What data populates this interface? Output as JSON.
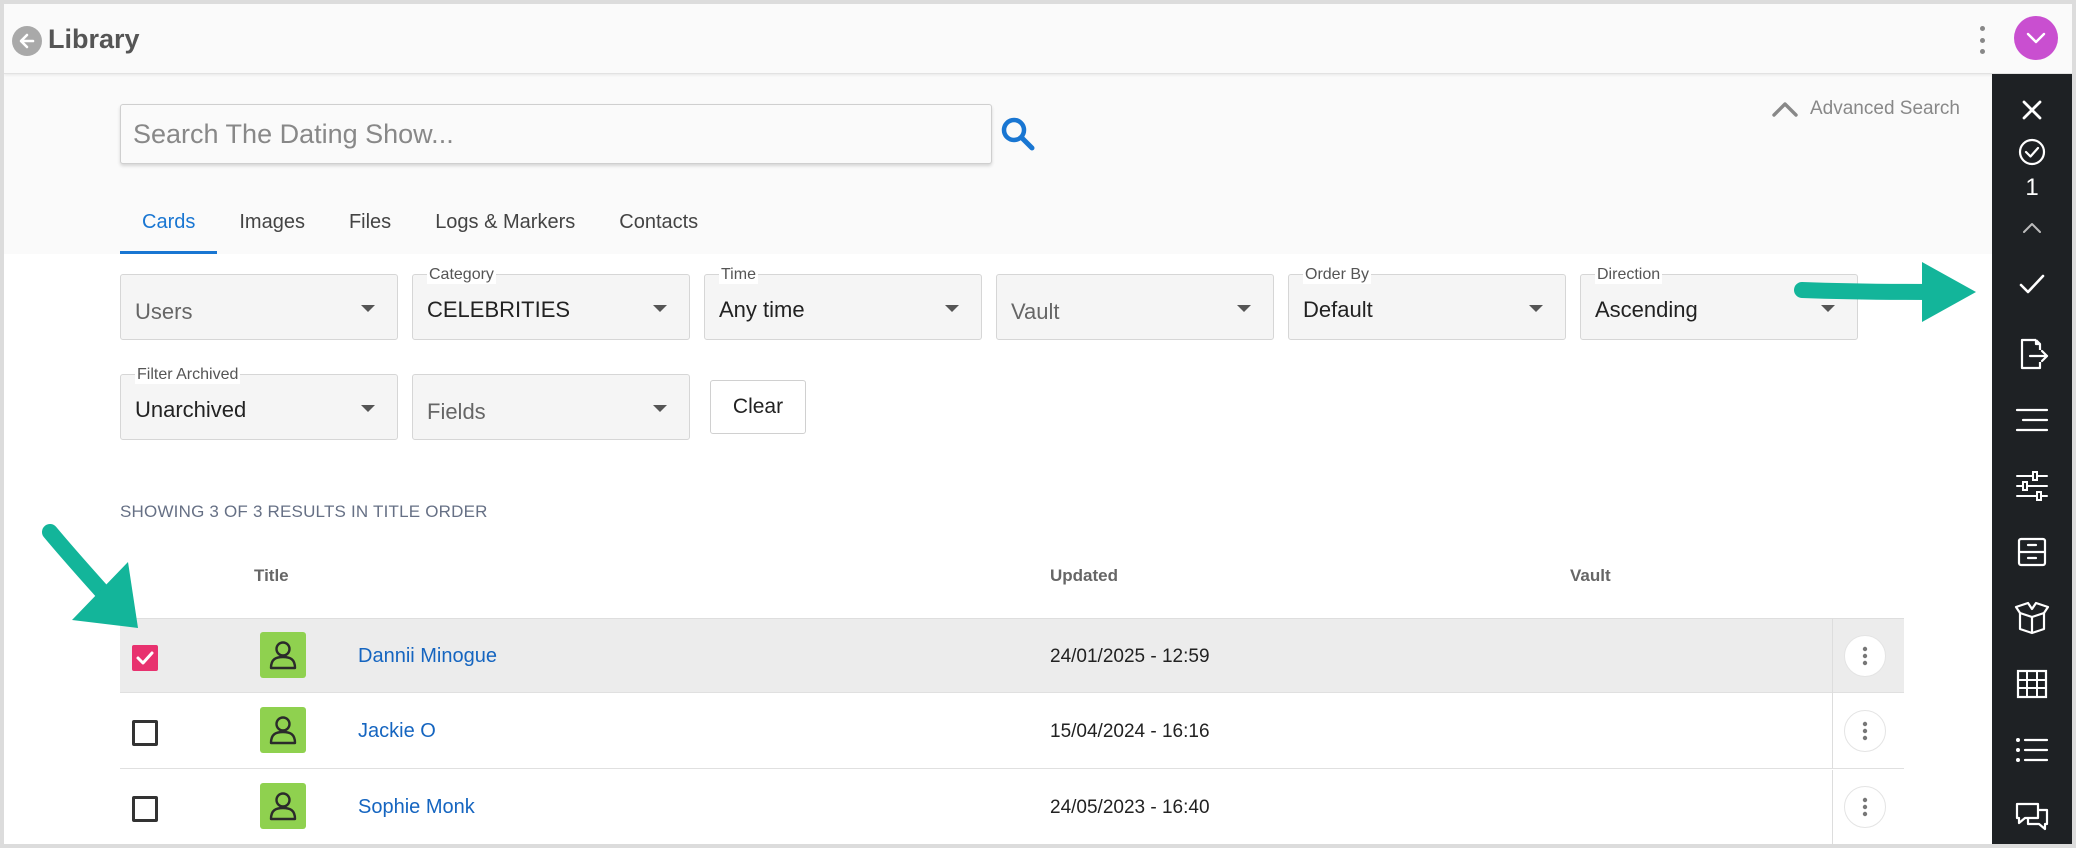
{
  "header": {
    "title": "Library"
  },
  "search": {
    "placeholder": "Search The Dating Show...",
    "value": "",
    "advanced_label": "Advanced Search"
  },
  "tabs": [
    {
      "label": "Cards",
      "active": true
    },
    {
      "label": "Images",
      "active": false
    },
    {
      "label": "Files",
      "active": false
    },
    {
      "label": "Logs & Markers",
      "active": false
    },
    {
      "label": "Contacts",
      "active": false
    }
  ],
  "filters": {
    "users": {
      "label": "",
      "value": "Users"
    },
    "category": {
      "label": "Category",
      "value": "CELEBRITIES"
    },
    "time": {
      "label": "Time",
      "value": "Any time"
    },
    "vault": {
      "label": "",
      "value": "Vault"
    },
    "order_by": {
      "label": "Order By",
      "value": "Default"
    },
    "direction": {
      "label": "Direction",
      "value": "Ascending"
    },
    "filter_archived": {
      "label": "Filter Archived",
      "value": "Unarchived"
    },
    "fields": {
      "label": "",
      "value": "Fields"
    },
    "clear_label": "Clear"
  },
  "results": {
    "summary": "SHOWING 3 OF 3 RESULTS IN TITLE ORDER",
    "columns": {
      "title": "Title",
      "updated": "Updated",
      "vault": "Vault"
    },
    "rows": [
      {
        "title": "Dannii Minogue",
        "updated": "24/01/2025 - 12:59",
        "vault": "",
        "checked": true
      },
      {
        "title": "Jackie O",
        "updated": "15/04/2024 - 16:16",
        "vault": "",
        "checked": false
      },
      {
        "title": "Sophie Monk",
        "updated": "24/05/2023 - 16:40",
        "vault": "",
        "checked": false
      }
    ]
  },
  "side_panel": {
    "selected_count": "1",
    "icons": [
      "close-icon",
      "check-circle-icon",
      "chevron-up-icon",
      "check-icon",
      "export-icon",
      "lines-icon",
      "sliders-icon",
      "archive-icon",
      "box-icon",
      "grid-icon",
      "list-icon",
      "chat-icon"
    ]
  },
  "colors": {
    "accent": "#1976d2",
    "checkbox_checked": "#e8326f",
    "avatar": "#c94fd0",
    "side_panel": "#1e2124",
    "thumb": "#8fd14f",
    "annotation_arrow": "#13b59a"
  }
}
